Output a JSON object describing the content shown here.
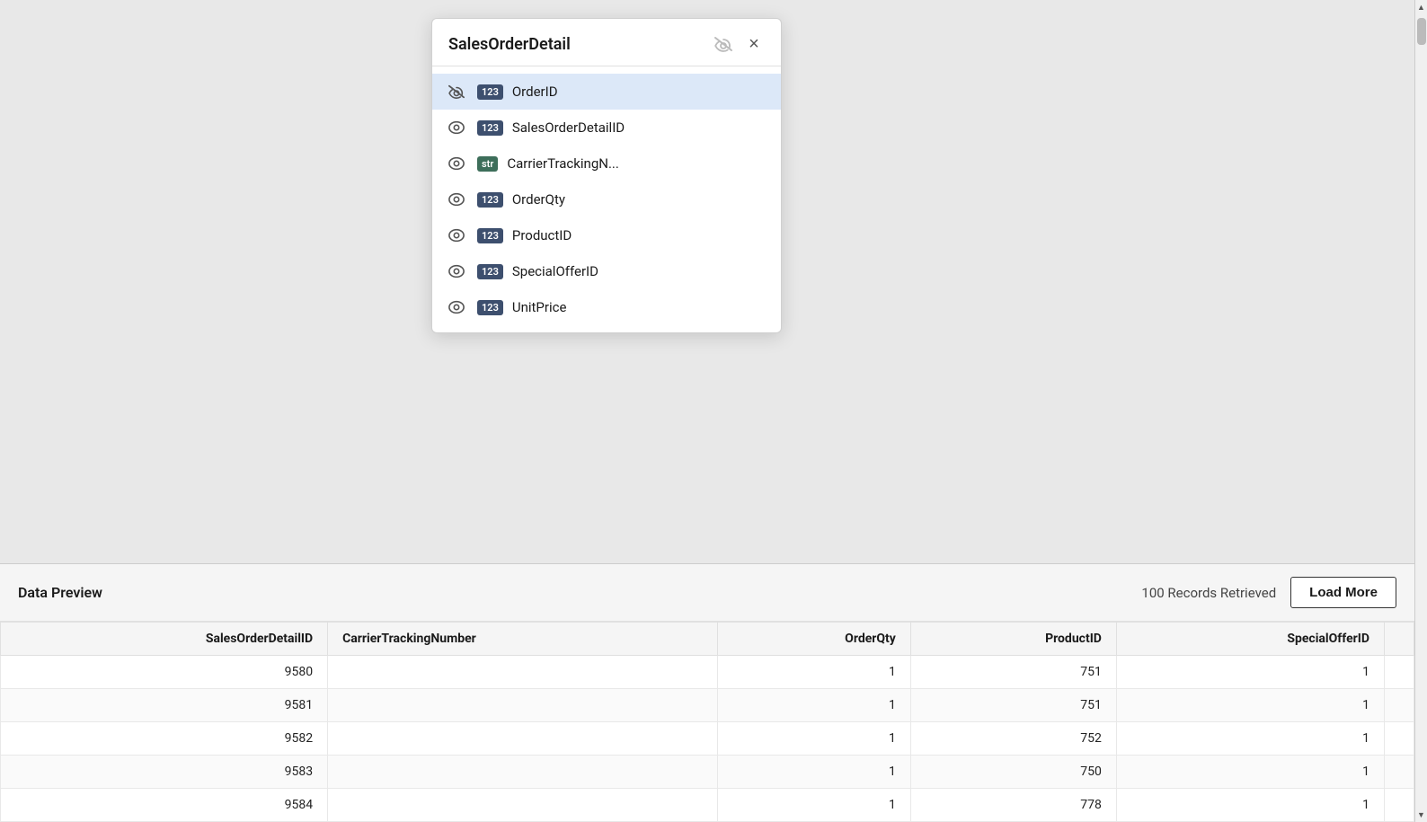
{
  "modal": {
    "title": "SalesOrderDetail",
    "fields": [
      {
        "id": "OrderID",
        "name": "OrderID",
        "type": "num",
        "typeLabel": "123",
        "visible": false,
        "selected": true
      },
      {
        "id": "SalesOrderDetailID",
        "name": "SalesOrderDetailID",
        "type": "num",
        "typeLabel": "123",
        "visible": true,
        "selected": false
      },
      {
        "id": "CarrierTrackingN",
        "name": "CarrierTrackingN...",
        "type": "str",
        "typeLabel": "str",
        "visible": true,
        "selected": false
      },
      {
        "id": "OrderQty",
        "name": "OrderQty",
        "type": "num",
        "typeLabel": "123",
        "visible": true,
        "selected": false
      },
      {
        "id": "ProductID",
        "name": "ProductID",
        "type": "num",
        "typeLabel": "123",
        "visible": true,
        "selected": false
      },
      {
        "id": "SpecialOfferID",
        "name": "SpecialOfferID",
        "type": "num",
        "typeLabel": "123",
        "visible": true,
        "selected": false
      },
      {
        "id": "UnitPrice",
        "name": "UnitPrice",
        "type": "num",
        "typeLabel": "123",
        "visible": true,
        "selected": false
      }
    ],
    "hide_icon_label": "hide",
    "close_label": "×"
  },
  "dataPreview": {
    "title": "Data Preview",
    "records_info": "100 Records Retrieved",
    "load_more_label": "Load More",
    "columns": [
      "SalesOrderDetailID",
      "CarrierTrackingNumber",
      "OrderQty",
      "ProductID",
      "SpecialOfferID"
    ],
    "rows": [
      {
        "SalesOrderDetailID": "9580",
        "CarrierTrackingNumber": "",
        "OrderQty": "1",
        "ProductID": "751",
        "SpecialOfferID": "1"
      },
      {
        "SalesOrderDetailID": "9581",
        "CarrierTrackingNumber": "",
        "OrderQty": "1",
        "ProductID": "751",
        "SpecialOfferID": "1"
      },
      {
        "SalesOrderDetailID": "9582",
        "CarrierTrackingNumber": "",
        "OrderQty": "1",
        "ProductID": "752",
        "SpecialOfferID": "1"
      },
      {
        "SalesOrderDetailID": "9583",
        "CarrierTrackingNumber": "",
        "OrderQty": "1",
        "ProductID": "750",
        "SpecialOfferID": "1"
      },
      {
        "SalesOrderDetailID": "9584",
        "CarrierTrackingNumber": "",
        "OrderQty": "1",
        "ProductID": "778",
        "SpecialOfferID": "1"
      }
    ]
  },
  "scrollbar": {
    "up_arrow": "▲",
    "down_arrow": "▼"
  }
}
